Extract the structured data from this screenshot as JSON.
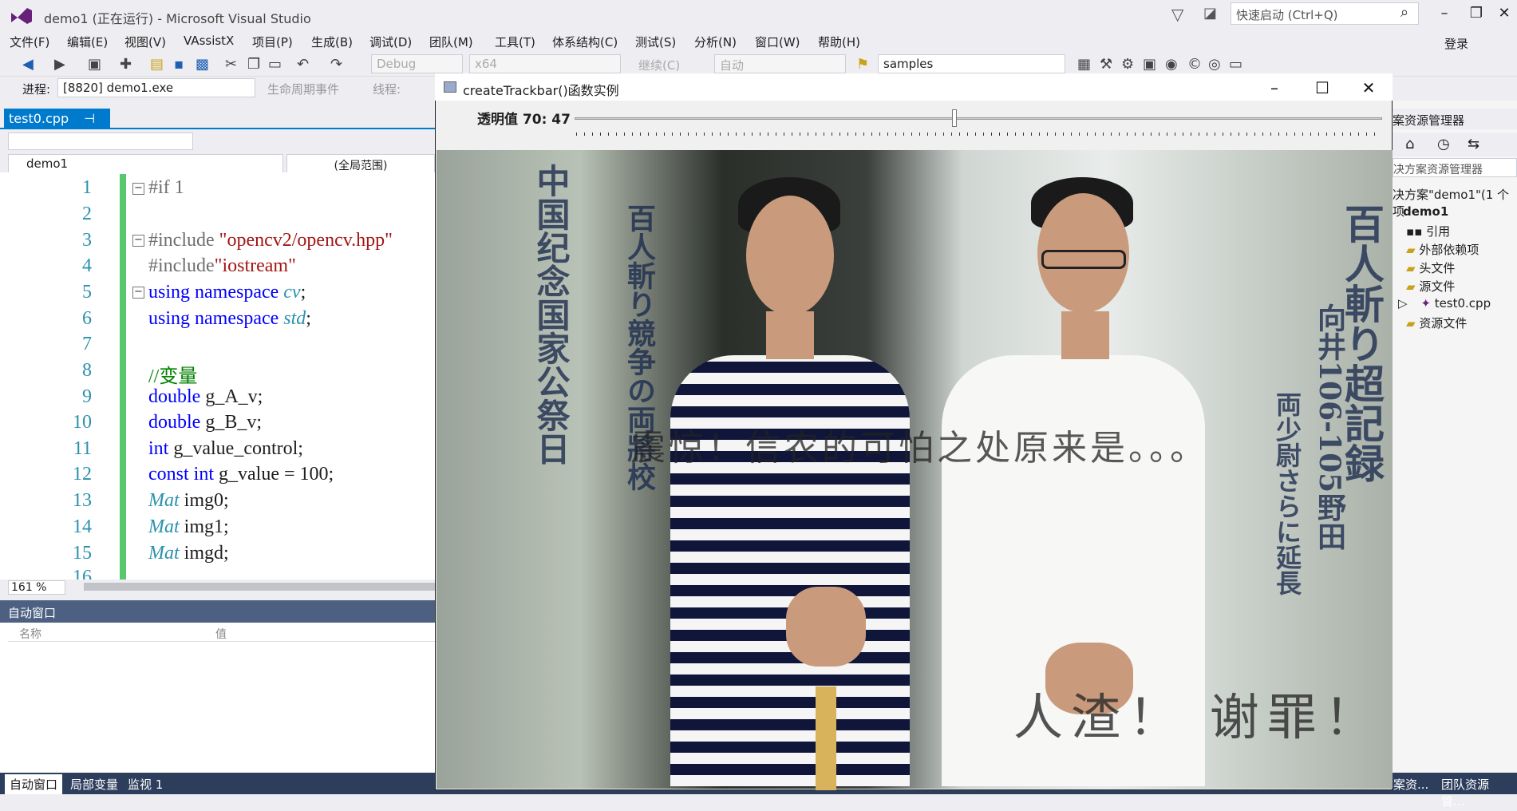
{
  "app": {
    "title": "demo1 (正在运行) - Microsoft Visual Studio",
    "quick_launch_placeholder": "快速启动 (Ctrl+Q)",
    "login": "登录"
  },
  "menu": [
    "文件(F)",
    "编辑(E)",
    "视图(V)",
    "VAssistX",
    "项目(P)",
    "生成(B)",
    "调试(D)",
    "团队(M)",
    "工具(T)",
    "体系结构(C)",
    "测试(S)",
    "分析(N)",
    "窗口(W)",
    "帮助(H)"
  ],
  "toolbar": {
    "config": "Debug",
    "platform": "x64",
    "continue": "继续(C)",
    "auto": "自动",
    "solution_combo": "samples"
  },
  "process": {
    "label": "进程:",
    "value": "[8820] demo1.exe",
    "lifecycle": "生命周期事件",
    "thread": "线程:"
  },
  "editor": {
    "tab": "test0.cpp",
    "nav_project": "demo1",
    "nav_scope": "(全局范围)",
    "zoom": "161 %",
    "lines": [
      "1",
      "2",
      "3",
      "4",
      "5",
      "6",
      "7",
      "8",
      "9",
      "10",
      "11",
      "12",
      "13",
      "14",
      "15",
      "16"
    ],
    "code": {
      "l1": "#if 1",
      "l3a": "#include ",
      "l3b": "\"opencv2/opencv.hpp\"",
      "l4a": "#include",
      "l4b": "\"iostream\"",
      "l5a": "using namespace ",
      "l5b": "cv",
      "l5c": ";",
      "l6a": "using namespace ",
      "l6b": "std",
      "l6c": ";",
      "l8": "//变量",
      "l9a": "double",
      "l9b": " g_A_v;",
      "l10a": "double",
      "l10b": " g_B_v;",
      "l11a": "int",
      "l11b": " g_value_control;",
      "l12a": "const int",
      "l12b": " g_value = 100;",
      "l13a": "Mat",
      "l13b": " img0;",
      "l14a": "Mat",
      "l14b": " img1;",
      "l15a": "Mat",
      "l15b": " imgd;"
    }
  },
  "auto_window": {
    "title": "自动窗口",
    "col_name": "名称",
    "col_value": "值"
  },
  "bottom_tabs": [
    "自动窗口",
    "局部变量",
    "监视 1",
    "案资...",
    "团队资源管..."
  ],
  "solution_explorer": {
    "title": "案资源管理器",
    "search": "决方案资源管理器",
    "solution": "决方案\"demo1\"(1 个项",
    "project": "demo1",
    "items": [
      "引用",
      "外部依赖项",
      "头文件",
      "源文件",
      "test0.cpp",
      "资源文件"
    ]
  },
  "cv_window": {
    "title": "createTrackbar()函数实例",
    "trackbar_label": "透明值 70: 47",
    "trackbar_value": 47,
    "trackbar_max": 70,
    "overlay_text": "震惊！信农的可怕之处原来是。。。",
    "bottom_text": "人渣！ 谢罪！",
    "banner_left": "百人斬り競争の両將校",
    "banner_right": "百人斬り超記録",
    "banner_right2": "向井106-105野田",
    "banner_right3": "両少尉さらに延長"
  }
}
